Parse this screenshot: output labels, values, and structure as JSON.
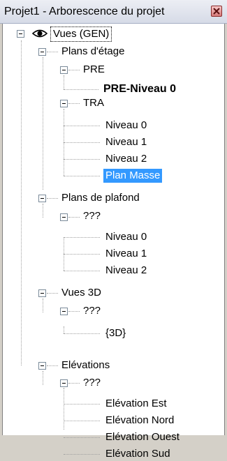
{
  "window": {
    "title": "Projet1 - Arborescence du projet"
  },
  "tree": {
    "root": "Vues (GEN)",
    "floor_plans": "Plans d'étage",
    "pre_group": "PRE",
    "pre_level0": "PRE-Niveau 0",
    "tra_group": "TRA",
    "tra_level0": "Niveau 0",
    "tra_level1": "Niveau 1",
    "tra_level2": "Niveau 2",
    "site_plan": "Plan Masse",
    "ceiling_plans": "Plans de plafond",
    "ceiling_group": "???",
    "ceiling_level0": "Niveau 0",
    "ceiling_level1": "Niveau 1",
    "ceiling_level2": "Niveau 2",
    "views_3d": "Vues 3D",
    "views_3d_group": "???",
    "view_3d": "{3D}",
    "elevations": "Elévations",
    "elevations_group": "???",
    "elev_east": "Elévation Est",
    "elev_north": "Elévation Nord",
    "elev_west": "Elévation Ouest",
    "elev_south": "Elévation Sud"
  },
  "icons": {
    "close": "close-icon",
    "eye": "eye-icon"
  },
  "colors": {
    "selection": "#3399ff"
  }
}
